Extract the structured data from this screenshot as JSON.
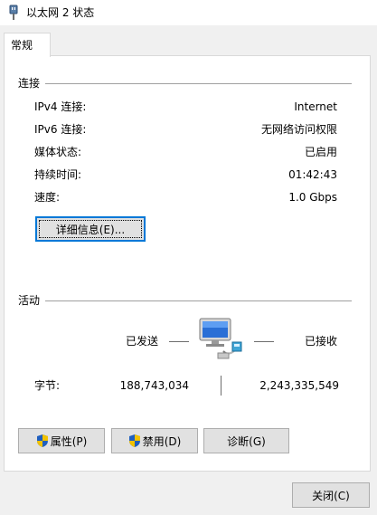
{
  "window": {
    "title": "以太网 2 状态"
  },
  "tabs": [
    {
      "label": "常规"
    }
  ],
  "connection": {
    "group_label": "连接",
    "rows": [
      {
        "label": "IPv4 连接:",
        "value": "Internet"
      },
      {
        "label": "IPv6 连接:",
        "value": "无网络访问权限"
      },
      {
        "label": "媒体状态:",
        "value": "已启用"
      },
      {
        "label": "持续时间:",
        "value": "01:42:43"
      },
      {
        "label": "速度:",
        "value": "1.0 Gbps"
      }
    ],
    "details_button": "详细信息(E)..."
  },
  "activity": {
    "group_label": "活动",
    "sent_label": "已发送",
    "received_label": "已接收",
    "bytes_label": "字节:",
    "bytes_sent": "188,743,034",
    "bytes_received": "2,243,335,549"
  },
  "actions": {
    "properties": "属性(P)",
    "disable": "禁用(D)",
    "diagnose": "诊断(G)",
    "close": "关闭(C)"
  },
  "icons": {
    "title": "network-adapter-icon",
    "activity": "network-computer-icon",
    "uac": "uac-shield-icon"
  },
  "colors": {
    "accent": "#0078d7",
    "shield_blue": "#1f5fbf",
    "shield_yellow": "#f2c200"
  }
}
